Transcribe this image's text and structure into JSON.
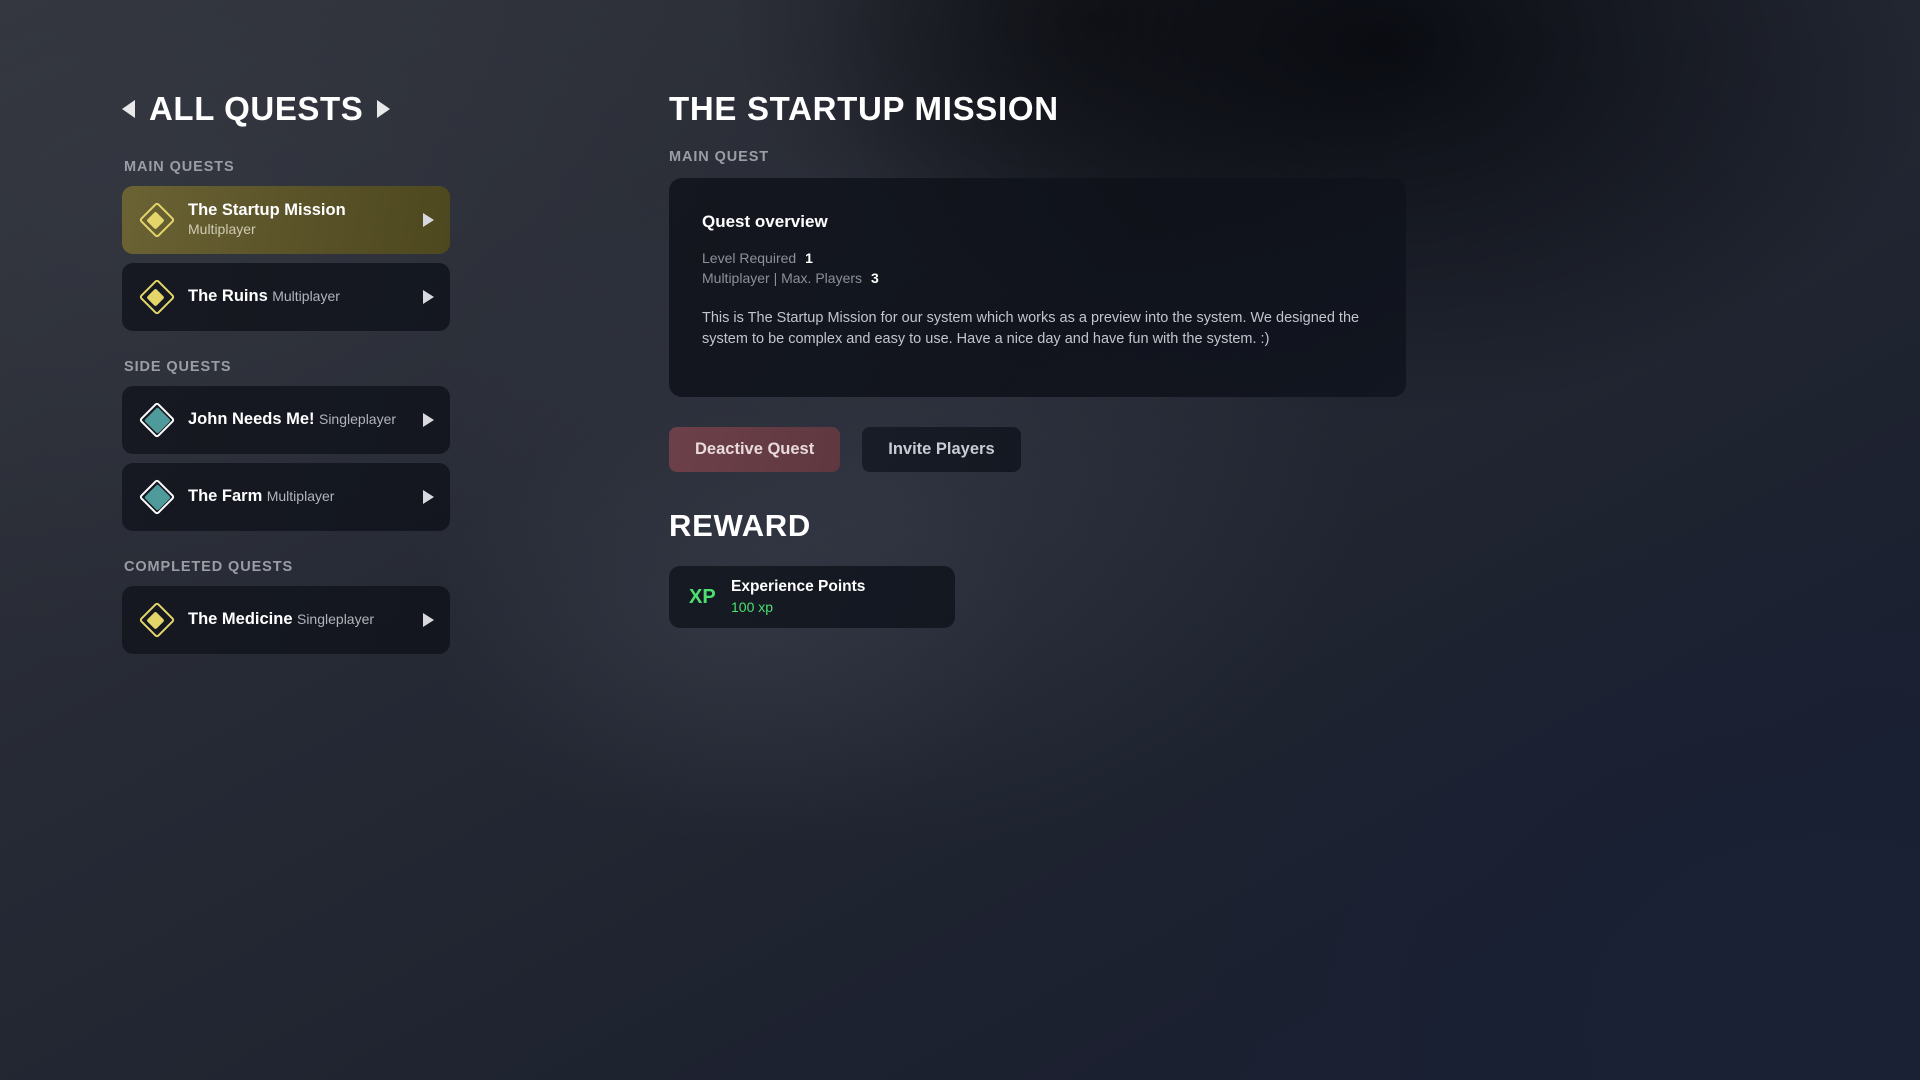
{
  "quest_log": {
    "header": {
      "title": "ALL QUESTS",
      "prev_icon": "triangle-left-icon",
      "next_icon": "triangle-right-icon"
    },
    "groups": [
      {
        "label": "MAIN QUESTS",
        "items": [
          {
            "name": "The Startup Mission",
            "mode": "Multiplayer",
            "icon": "diamond-outline-icon",
            "icon_color": "#e5d66a",
            "selected": true
          },
          {
            "name": "The Ruins",
            "mode": "Multiplayer",
            "icon": "diamond-outline-icon",
            "icon_color": "#e5d66a",
            "selected": false
          }
        ]
      },
      {
        "label": "SIDE QUESTS",
        "items": [
          {
            "name": "John Needs Me!",
            "mode": "Singleplayer",
            "icon": "diamond-filled-icon",
            "icon_color": "#4f9a9a",
            "selected": false
          },
          {
            "name": "The Farm",
            "mode": "Multiplayer",
            "icon": "diamond-filled-icon",
            "icon_color": "#4f9a9a",
            "selected": false
          }
        ]
      },
      {
        "label": "COMPLETED QUESTS",
        "items": [
          {
            "name": "The Medicine",
            "mode": "Singleplayer",
            "icon": "diamond-outline-icon",
            "icon_color": "#e5d66a",
            "selected": false
          }
        ]
      }
    ]
  },
  "detail": {
    "title": "THE STARTUP MISSION",
    "kicker": "MAIN QUEST",
    "overview": {
      "heading": "Quest overview",
      "level_label": "Level Required",
      "level_value": "1",
      "players_label": "Multiplayer | Max. Players",
      "players_value": "3",
      "description": "This is The Startup Mission for our system which works as a preview into the system. We designed the system to be complex and easy to use. Have a nice day and have fun with the system. :)"
    },
    "buttons": {
      "deactivate": "Deactive Quest",
      "invite": "Invite Players",
      "deactivate_color": "#6d4049"
    },
    "reward": {
      "heading": "REWARD",
      "items": [
        {
          "badge": "XP",
          "name": "Experience Points",
          "amount": "100 xp",
          "color": "#4ce070"
        }
      ]
    }
  }
}
